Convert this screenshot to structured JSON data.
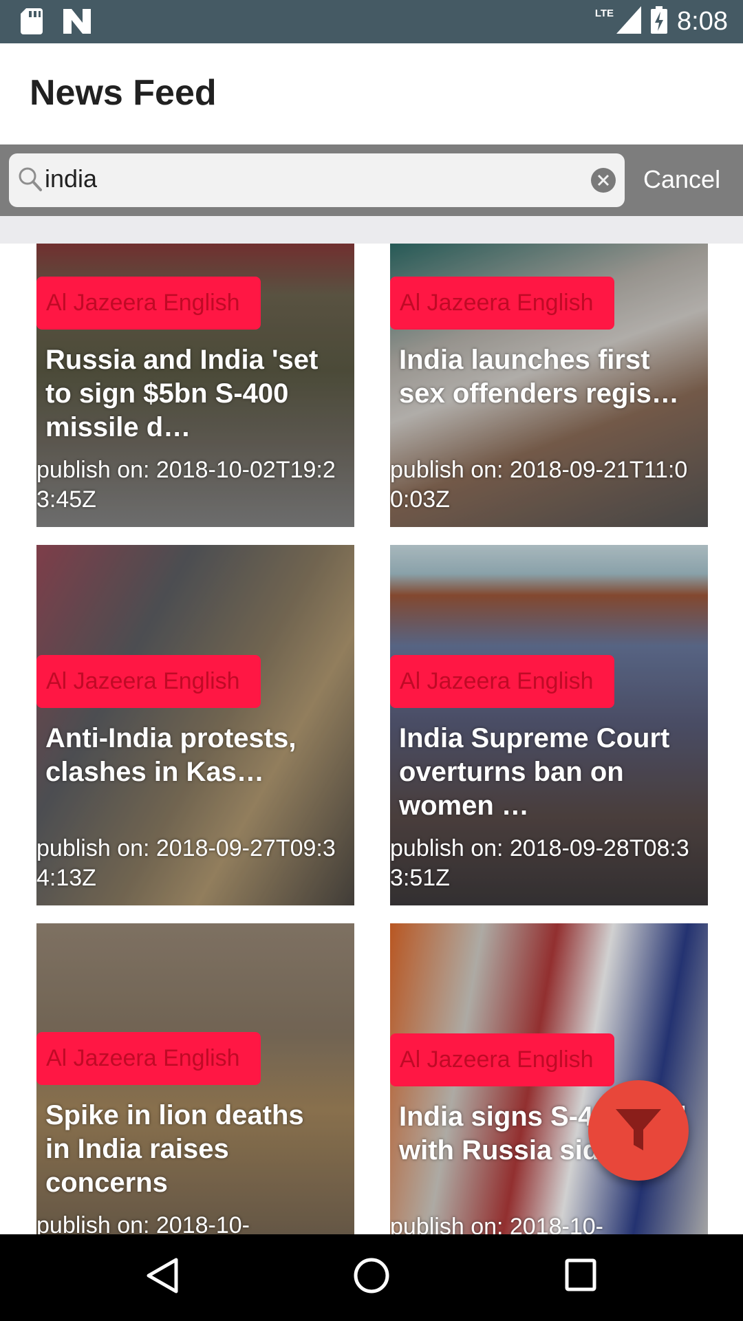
{
  "status_bar": {
    "time": "8:08",
    "network": "LTE",
    "icons": [
      "sd-card-icon",
      "n-logo-icon",
      "signal-icon",
      "battery-charging-icon"
    ]
  },
  "app_bar": {
    "title": "News Feed"
  },
  "search": {
    "query": "india",
    "cancel_label": "Cancel"
  },
  "articles": [
    {
      "source": "Al Jazeera English",
      "title": "Russia and India 'set to sign $5bn S-400 missile d…",
      "published": "publish on: 2018-10-02T19:23:45Z"
    },
    {
      "source": "Al Jazeera English",
      "title": "India launches first sex offenders regis…",
      "published": "publish on: 2018-09-21T11:00:03Z"
    },
    {
      "source": "Al Jazeera English",
      "title": "Anti-India protests, clashes in Kas…",
      "published": "publish on: 2018-09-27T09:34:13Z"
    },
    {
      "source": "Al Jazeera English",
      "title": "India Supreme Court overturns ban on women …",
      "published": "publish on: 2018-09-28T08:33:51Z"
    },
    {
      "source": "Al Jazeera English",
      "title": "Spike in lion deaths in India raises concerns",
      "published": "publish on: 2018-10-"
    },
    {
      "source": "Al Jazeera English",
      "title": "India signs S-400 deal with Russia sid…",
      "published": "publish on: 2018-10-"
    }
  ],
  "colors": {
    "status_bar": "#455a64",
    "badge": "#ff1744",
    "fab": "#e8473a",
    "search_bar": "#7d7d7d"
  },
  "fab_icon": "filter-icon",
  "nav": {
    "icons": [
      "back-icon",
      "home-icon",
      "recents-icon"
    ]
  }
}
